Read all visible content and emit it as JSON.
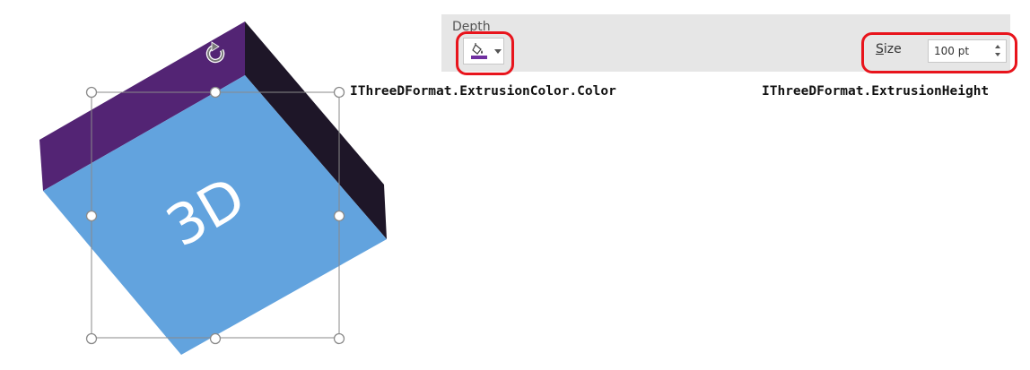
{
  "shape": {
    "label": "3D",
    "colors": {
      "front_face": "#62a3de",
      "top_face": "#532474",
      "side_face": "#1e1628",
      "selection_handle": "#8a8a8a"
    }
  },
  "depth_panel": {
    "title": "Depth",
    "color_button": {
      "icon": "paint-bucket-icon",
      "swatch_color": "#7030a0"
    },
    "size_label_mnemonic": "S",
    "size_label_rest": "ize",
    "size_value": "100 pt"
  },
  "captions": {
    "extrusion_color": "IThreeDFormat.ExtrusionColor.Color",
    "extrusion_height": "IThreeDFormat.ExtrusionHeight"
  },
  "highlight_color": "#e8141c"
}
